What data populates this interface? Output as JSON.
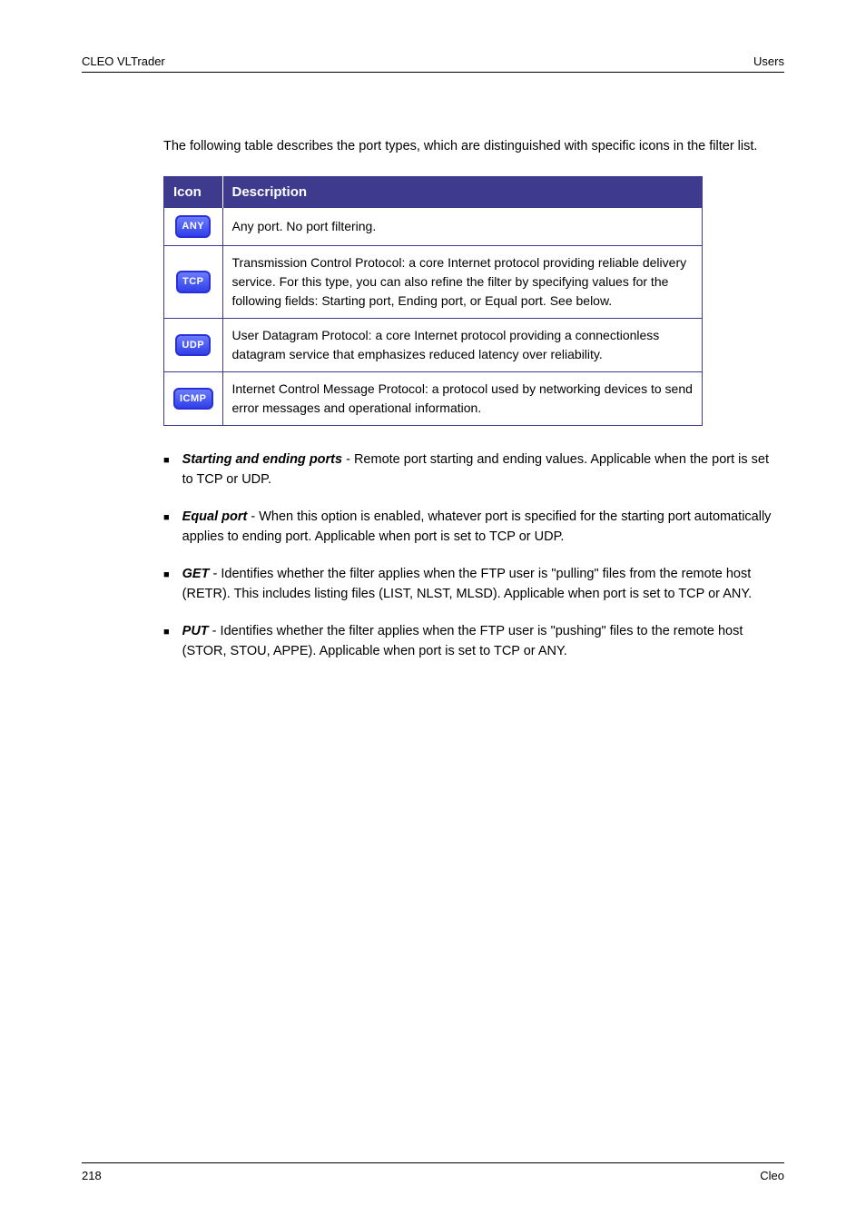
{
  "header": {
    "doc_title": "CLEO VLTrader",
    "chapter": "Users"
  },
  "footer": {
    "page": "218",
    "copyright": "Cleo"
  },
  "intro": "The following table describes the port types, which are distinguished with specific icons in the filter list.",
  "table": {
    "headers": [
      "Icon",
      "Description"
    ],
    "rows": [
      {
        "badge": "ANY",
        "desc": "Any port. No port filtering."
      },
      {
        "badge": "TCP",
        "desc": "Transmission Control Protocol: a core Internet protocol providing reliable delivery service. For this type, you can also refine the filter by specifying values for the following fields: Starting port, Ending port, or Equal port. See below."
      },
      {
        "badge": "UDP",
        "desc": "User Datagram Protocol: a core Internet protocol providing a connectionless datagram service that emphasizes reduced latency over reliability."
      },
      {
        "badge": "ICMP",
        "desc": "Internet Control Message Protocol: a protocol used by networking devices to send error messages and operational information."
      }
    ]
  },
  "list": [
    {
      "term": "Starting and ending ports",
      "body": " - Remote port starting and ending values. Applicable when the port is set to TCP or UDP."
    },
    {
      "term": "Equal port",
      "body": " - When this option is enabled, whatever port is specified for the starting port automatically applies to ending port. Applicable when port is set to TCP or UDP."
    },
    {
      "term": "GET",
      "body": " - Identifies whether the filter applies when the FTP user is \"pulling\" files from the remote host (RETR). This includes listing files (LIST, NLST, MLSD). Applicable when port is set to TCP or ANY."
    },
    {
      "term": "PUT",
      "body": " - Identifies whether the filter applies when the FTP user is \"pushing\" files to the remote host (STOR, STOU, APPE). Applicable when port is set to TCP or ANY."
    }
  ]
}
